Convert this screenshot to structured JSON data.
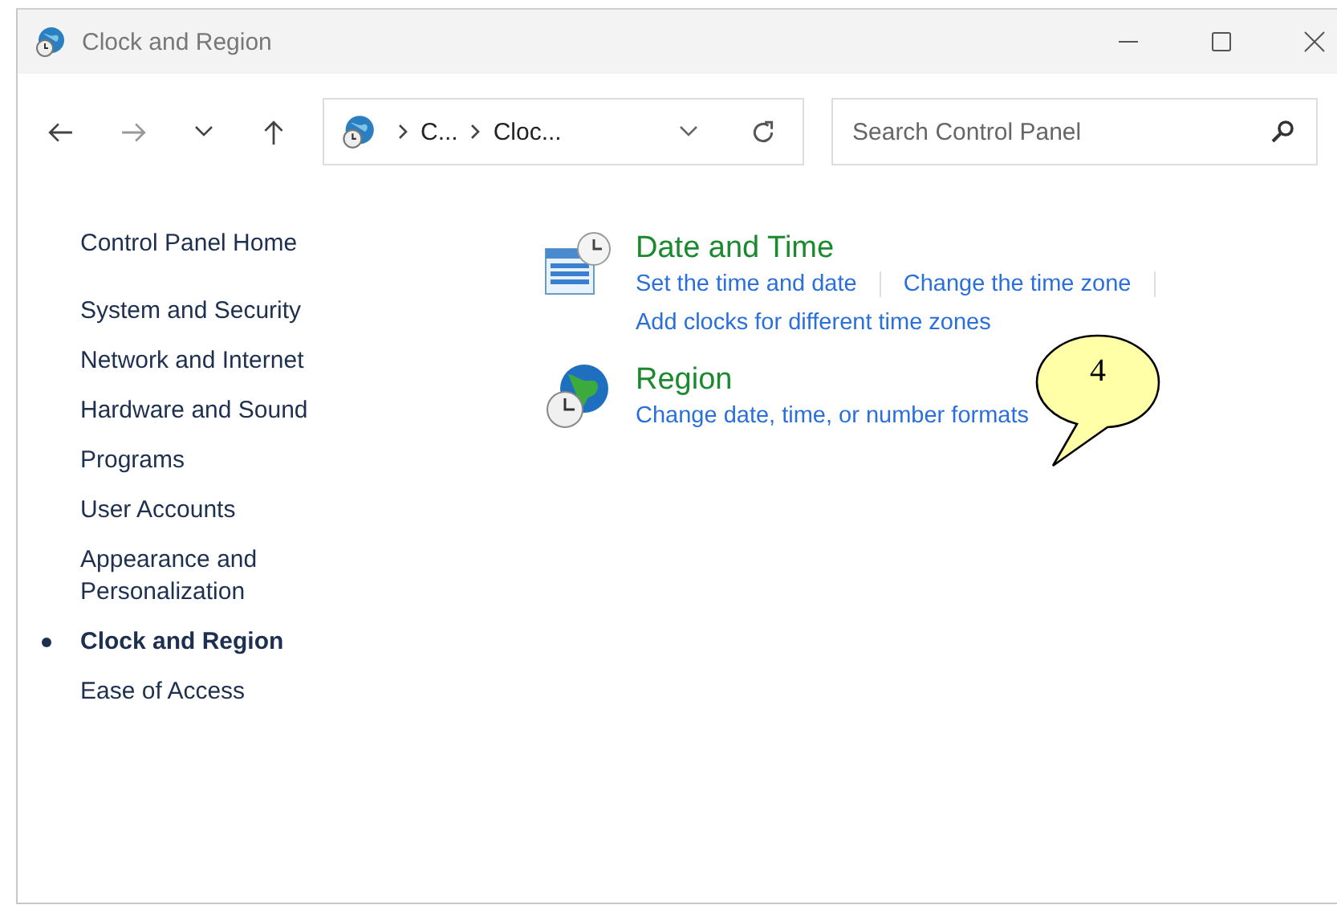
{
  "window": {
    "title": "Clock and Region"
  },
  "address": {
    "segments": [
      "C...",
      "Cloc..."
    ]
  },
  "search": {
    "placeholder": "Search Control Panel"
  },
  "sidebar": {
    "home": "Control Panel Home",
    "items": [
      {
        "label": "System and Security",
        "selected": false
      },
      {
        "label": "Network and Internet",
        "selected": false
      },
      {
        "label": "Hardware and Sound",
        "selected": false
      },
      {
        "label": "Programs",
        "selected": false
      },
      {
        "label": "User Accounts",
        "selected": false
      },
      {
        "label": "Appearance and Personalization",
        "selected": false
      },
      {
        "label": "Clock and Region",
        "selected": true
      },
      {
        "label": "Ease of Access",
        "selected": false
      }
    ]
  },
  "categories": [
    {
      "kind": "datetime",
      "title": "Date and Time",
      "links": [
        "Set the time and date",
        "Change the time zone",
        "Add clocks for different time zones"
      ]
    },
    {
      "kind": "region",
      "title": "Region",
      "links": [
        "Change date, time, or number formats"
      ]
    }
  ],
  "callout": {
    "text": "4"
  }
}
